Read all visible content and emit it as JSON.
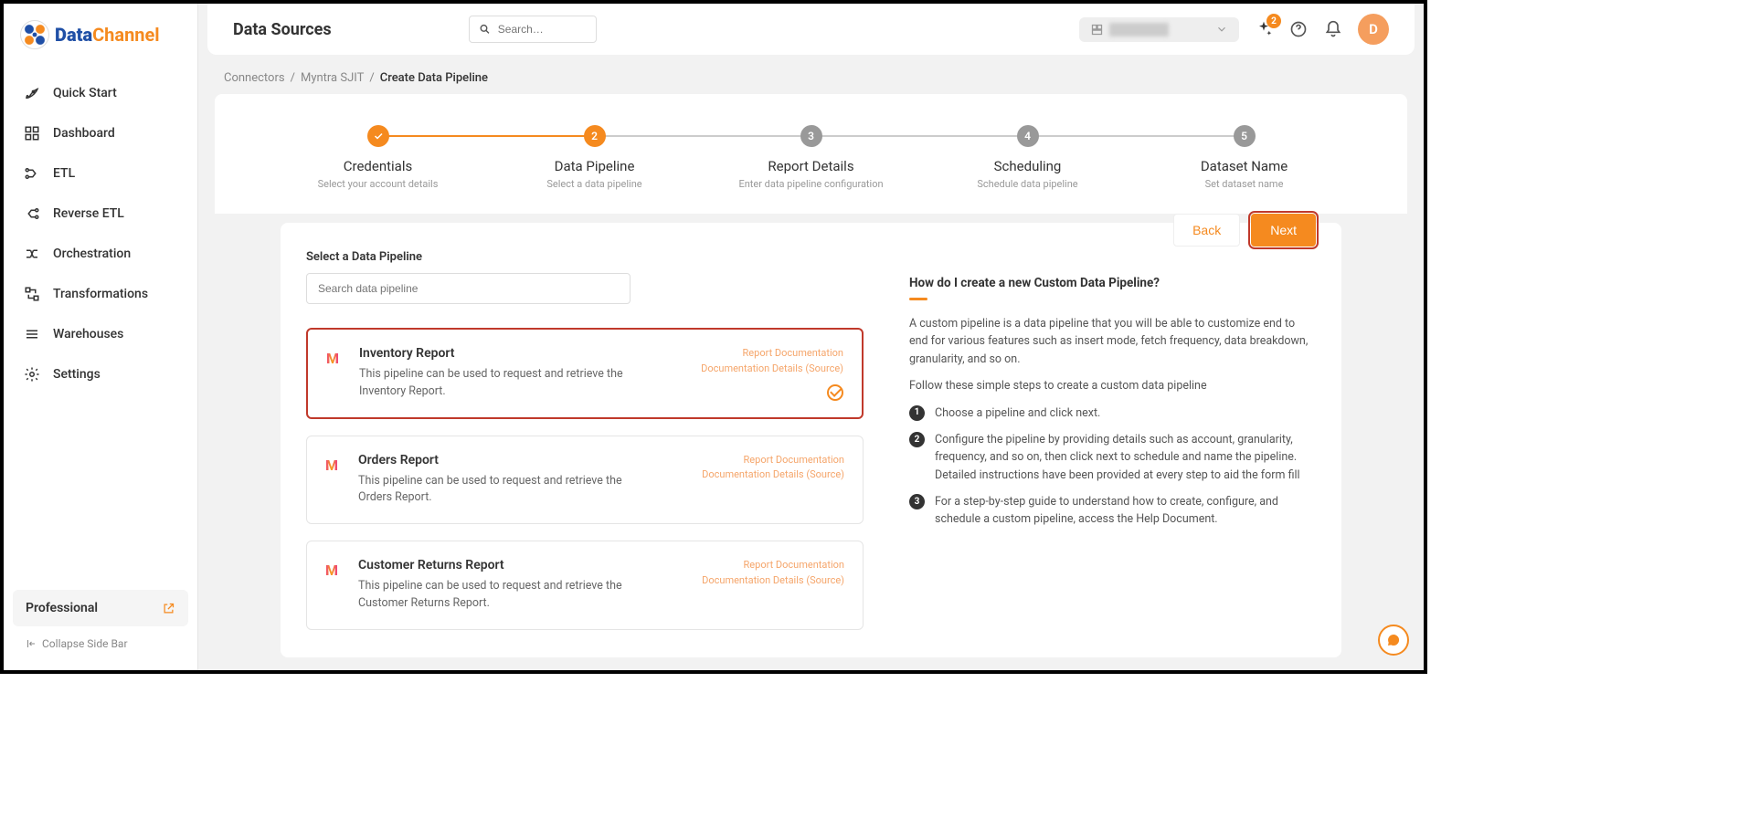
{
  "brand": {
    "part1": "Data",
    "part2": "Channel"
  },
  "sidebar": {
    "items": [
      {
        "label": "Quick Start"
      },
      {
        "label": "Dashboard"
      },
      {
        "label": "ETL"
      },
      {
        "label": "Reverse ETL"
      },
      {
        "label": "Orchestration"
      },
      {
        "label": "Transformations"
      },
      {
        "label": "Warehouses"
      },
      {
        "label": "Settings"
      }
    ],
    "plan": "Professional",
    "collapse": "Collapse Side Bar"
  },
  "topbar": {
    "title": "Data Sources",
    "search_placeholder": "Search…",
    "workspace_label": "Workspace",
    "notif_count": "2",
    "avatar_initial": "D"
  },
  "breadcrumb": {
    "a": "Connectors",
    "b": "Myntra SJIT",
    "c": "Create Data Pipeline"
  },
  "stepper": [
    {
      "num": "✓",
      "title": "Credentials",
      "sub": "Select your account details",
      "state": "done"
    },
    {
      "num": "2",
      "title": "Data Pipeline",
      "sub": "Select a data pipeline",
      "state": "active"
    },
    {
      "num": "3",
      "title": "Report Details",
      "sub": "Enter data pipeline configuration",
      "state": "pending"
    },
    {
      "num": "4",
      "title": "Scheduling",
      "sub": "Schedule data pipeline",
      "state": "pending"
    },
    {
      "num": "5",
      "title": "Dataset Name",
      "sub": "Set dataset name",
      "state": "pending"
    }
  ],
  "panel": {
    "section_label": "Select a Data Pipeline",
    "search_placeholder": "Search data pipeline",
    "back": "Back",
    "next": "Next"
  },
  "pipelines": [
    {
      "title": "Inventory Report",
      "desc": "This pipeline can be used to request and retrieve the Inventory Report.",
      "link1": "Report Documentation",
      "link2": "Documentation Details (Source)",
      "selected": true
    },
    {
      "title": "Orders Report",
      "desc": "This pipeline can be used to request and retrieve the Orders Report.",
      "link1": "Report Documentation",
      "link2": "Documentation Details (Source)",
      "selected": false
    },
    {
      "title": "Customer Returns Report",
      "desc": "This pipeline can be used to request and retrieve the Customer Returns Report.",
      "link1": "Report Documentation",
      "link2": "Documentation Details (Source)",
      "selected": false
    }
  ],
  "help": {
    "title": "How do I create a new Custom Data Pipeline?",
    "p1": "A custom pipeline is a data pipeline that you will be able to customize end to end for various features such as insert mode, fetch frequency, data breakdown, granularity, and so on.",
    "p2": "Follow these simple steps to create a custom data pipeline",
    "steps": [
      "Choose a pipeline and click next.",
      "Configure the pipeline by providing details such as account, granularity, frequency, and so on, then click next to schedule and name the pipeline. Detailed instructions have been provided at every step to aid the form fill",
      "For a step-by-step guide to understand how to create, configure, and schedule a custom pipeline, access the Help Document."
    ]
  }
}
